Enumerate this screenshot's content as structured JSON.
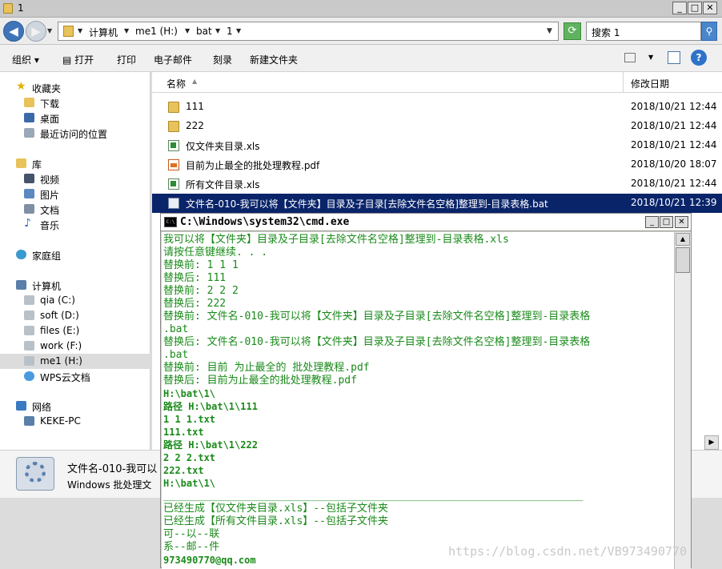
{
  "explorer": {
    "title": "1",
    "breadcrumbs": [
      "计算机",
      "me1 (H:)",
      "bat",
      "1"
    ],
    "search_placeholder": "搜索 1",
    "toolbar": {
      "organize": "组织",
      "open": "打开",
      "print": "打印",
      "email": "电子邮件",
      "burn": "刻录",
      "new_folder": "新建文件夹"
    },
    "nav": {
      "favorites": "收藏夹",
      "downloads": "下载",
      "desktop": "桌面",
      "recent": "最近访问的位置",
      "libraries": "库",
      "videos": "视频",
      "pictures": "图片",
      "documents": "文档",
      "music": "音乐",
      "homegroup": "家庭组",
      "computer": "计算机",
      "drive_c": "qia (C:)",
      "drive_d": "soft (D:)",
      "drive_e": "files (E:)",
      "drive_f": "work (F:)",
      "drive_h": "me1 (H:)",
      "wps": "WPS云文档",
      "network": "网络",
      "pc": "KEKE-PC"
    },
    "columns": {
      "name": "名称",
      "date": "修改日期"
    },
    "files": [
      {
        "name": "111",
        "date": "2018/10/21 12:44",
        "type": "folder"
      },
      {
        "name": "222",
        "date": "2018/10/21 12:44",
        "type": "folder"
      },
      {
        "name": "仅文件夹目录.xls",
        "date": "2018/10/21 12:44",
        "type": "xls"
      },
      {
        "name": "目前为止最全的批处理教程.pdf",
        "date": "2018/10/20 18:07",
        "type": "pdf"
      },
      {
        "name": "所有文件目录.xls",
        "date": "2018/10/21 12:44",
        "type": "xls"
      },
      {
        "name": "文件名-010-我可以将【文件夹】目录及子目录[去除文件名空格]整理到-目录表格.bat",
        "date": "2018/10/21 12:39",
        "type": "bat"
      }
    ],
    "details": {
      "name": "文件名-010-我可以",
      "type": "Windows 批处理文"
    }
  },
  "cmd": {
    "title": "C:\\Windows\\system32\\cmd.exe",
    "icon_text": "C:\\",
    "lines": [
      "我可以将【文件夹】目录及子目录[去除文件名空格]整理到-目录表格.xls",
      "请按任意键继续. . .",
      "替换前: 1 1 1",
      "替换后: 111",
      "替换前: 2 2 2",
      "替换后: 222",
      "替换前: 文件名-010-我可以将【文件夹】目录及子目录[去除文件名空格]整理到-目录表格",
      ".bat",
      "替换后: 文件名-010-我可以将【文件夹】目录及子目录[去除文件名空格]整理到-目录表格",
      ".bat",
      "替换前: 目前 为止最全的 批处理教程.pdf",
      "替换后: 目前为止最全的批处理教程.pdf",
      "H:\\bat\\1\\",
      "路径 H:\\bat\\1\\111",
      "1 1 1.txt",
      "111.txt",
      "路径 H:\\bat\\1\\222",
      "2 2 2.txt",
      "222.txt",
      "H:\\bat\\1\\",
      "___________________________________________________________________",
      "已经生成【仅文件夹目录.xls】--包括子文件夹",
      "已经生成【所有文件目录.xls】--包括子文件夹",
      "可--以--联",
      "系--邮--件",
      "973490770@qq.com"
    ]
  },
  "watermark": "https://blog.csdn.net/VB973490770"
}
